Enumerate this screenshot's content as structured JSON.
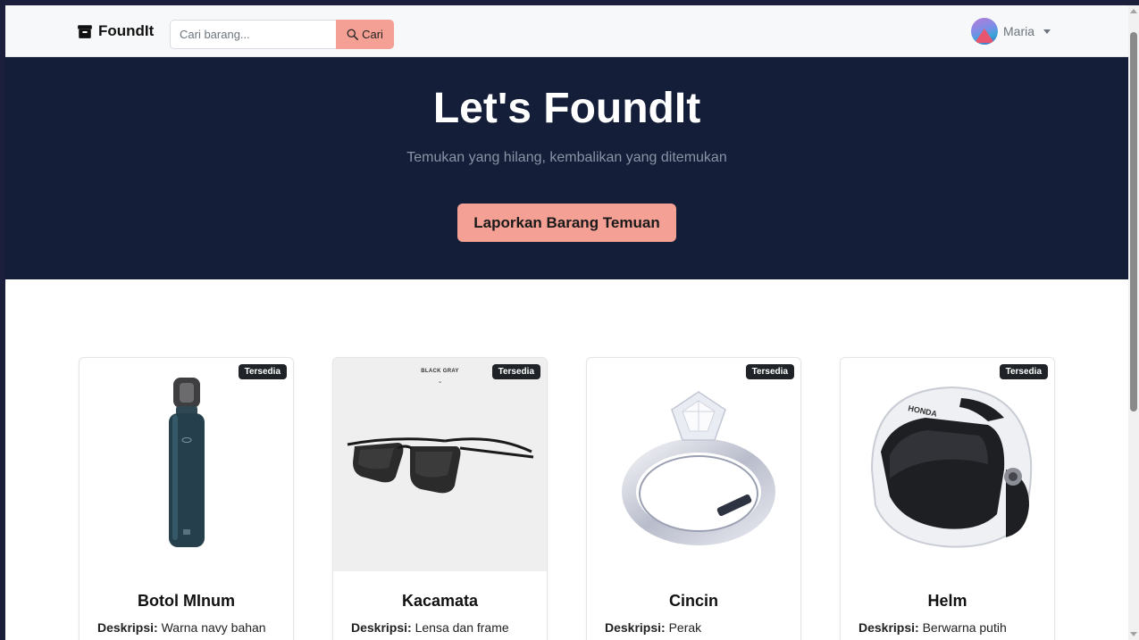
{
  "navbar": {
    "brand": "FoundIt",
    "search_placeholder": "Cari barang...",
    "search_button": "Cari",
    "user_name": "Maria"
  },
  "hero": {
    "title": "Let's FoundIt",
    "subtitle": "Temukan yang hilang, kembalikan yang ditemukan",
    "cta": "Laporkan Barang Temuan"
  },
  "items": [
    {
      "name": "Botol MInum",
      "badge": "Tersedia",
      "desc_label": "Deskripsi:",
      "desc": "Warna navy bahan",
      "icon": "bottle-image"
    },
    {
      "name": "Kacamata",
      "badge": "Tersedia",
      "desc_label": "Deskripsi:",
      "desc": "Lensa dan frame",
      "icon": "sunglasses-image",
      "image_caption": "BLACK GRAY"
    },
    {
      "name": "Cincin",
      "badge": "Tersedia",
      "desc_label": "Deskripsi:",
      "desc": "Perak",
      "icon": "ring-image"
    },
    {
      "name": "Helm",
      "badge": "Tersedia",
      "desc_label": "Deskripsi:",
      "desc": "Berwarna putih",
      "icon": "helmet-image",
      "image_caption": "HONDA"
    }
  ],
  "colors": {
    "accent": "#f5a094",
    "hero_bg": "#151e38",
    "badge_bg": "#1f2328"
  }
}
